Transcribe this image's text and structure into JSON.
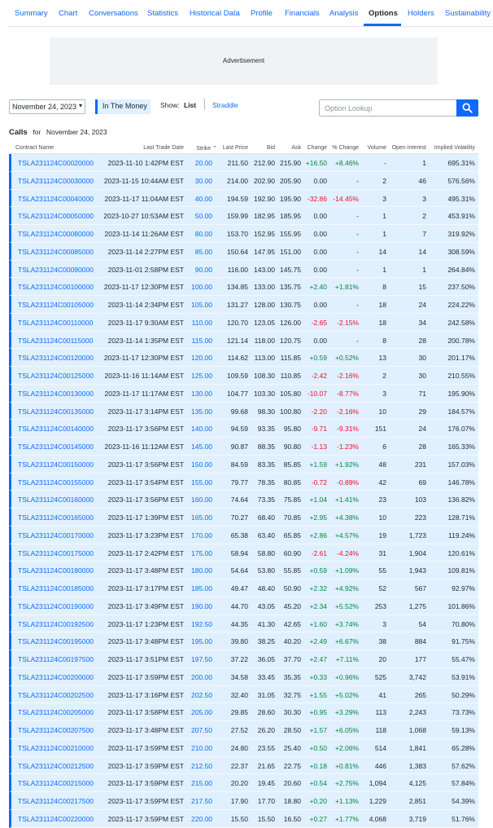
{
  "nav": {
    "tabs": [
      "Summary",
      "Chart",
      "Conversations",
      "Statistics",
      "Historical Data",
      "Profile",
      "Financials",
      "Analysis",
      "Options",
      "Holders",
      "Sustainability"
    ],
    "active": "Options"
  },
  "ad": {
    "label": "Advertisement"
  },
  "controls": {
    "expiration": "November 24, 2023",
    "in_the_money": "In The Money",
    "show_label": "Show:",
    "show_list": "List",
    "show_straddle": "Straddle",
    "lookup_placeholder": "Option Lookup"
  },
  "calls": {
    "title": "Calls",
    "for_label": "for",
    "date": "November 24, 2023"
  },
  "columns": {
    "contract": "Contract Name",
    "last_trade": "Last Trade Date",
    "strike": "Strike ⌃",
    "last_price": "Last Price",
    "bid": "Bid",
    "ask": "Ask",
    "change": "Change",
    "pct_change": "% Change",
    "volume": "Volume",
    "open_interest": "Open Interest",
    "implied_vol": "Implied Volatility"
  },
  "rows": [
    [
      "TSLA231124C00020000",
      "2023-11-10 1:42PM EST",
      "20.00",
      "211.50",
      "212.90",
      "215.90",
      "+16.50",
      "+8.46%",
      "-",
      "1",
      "695.31%"
    ],
    [
      "TSLA231124C00030000",
      "2023-11-15 10:44AM EST",
      "30.00",
      "214.00",
      "202.90",
      "205.90",
      "0.00",
      "-",
      "2",
      "46",
      "576.56%"
    ],
    [
      "TSLA231124C00040000",
      "2023-11-17 11:04AM EST",
      "40.00",
      "194.59",
      "192.90",
      "195.90",
      "-32.86",
      "-14.45%",
      "3",
      "3",
      "495.31%"
    ],
    [
      "TSLA231124C00050000",
      "2023-10-27 10:53AM EST",
      "50.00",
      "159.99",
      "182.95",
      "185.95",
      "0.00",
      "-",
      "1",
      "2",
      "453.91%"
    ],
    [
      "TSLA231124C00080000",
      "2023-11-14 11:26AM EST",
      "80.00",
      "153.70",
      "152.95",
      "155.95",
      "0.00",
      "-",
      "1",
      "7",
      "319.92%"
    ],
    [
      "TSLA231124C00085000",
      "2023-11-14 2:27PM EST",
      "85.00",
      "150.64",
      "147.95",
      "151.00",
      "0.00",
      "-",
      "14",
      "14",
      "308.59%"
    ],
    [
      "TSLA231124C00090000",
      "2023-11-01 2:58PM EST",
      "90.00",
      "116.00",
      "143.00",
      "145.75",
      "0.00",
      "-",
      "1",
      "1",
      "264.84%"
    ],
    [
      "TSLA231124C00100000",
      "2023-11-17 12:30PM EST",
      "100.00",
      "134.85",
      "133.00",
      "135.75",
      "+2.40",
      "+1.81%",
      "8",
      "15",
      "237.50%"
    ],
    [
      "TSLA231124C00105000",
      "2023-11-14 2:34PM EST",
      "105.00",
      "131.27",
      "128.00",
      "130.75",
      "0.00",
      "-",
      "18",
      "24",
      "224.22%"
    ],
    [
      "TSLA231124C00110000",
      "2023-11-17 9:30AM EST",
      "110.00",
      "120.70",
      "123.05",
      "126.00",
      "-2.65",
      "-2.15%",
      "18",
      "34",
      "242.58%"
    ],
    [
      "TSLA231124C00115000",
      "2023-11-14 1:35PM EST",
      "115.00",
      "121.14",
      "118.00",
      "120.75",
      "0.00",
      "-",
      "8",
      "28",
      "200.78%"
    ],
    [
      "TSLA231124C00120000",
      "2023-11-17 12:30PM EST",
      "120.00",
      "114.62",
      "113.00",
      "115.85",
      "+0.59",
      "+0.52%",
      "13",
      "30",
      "201.17%"
    ],
    [
      "TSLA231124C00125000",
      "2023-11-16 11:14AM EST",
      "125.00",
      "109.59",
      "108.30",
      "110.85",
      "-2.42",
      "-2.16%",
      "2",
      "30",
      "210.55%"
    ],
    [
      "TSLA231124C00130000",
      "2023-11-17 11:17AM EST",
      "130.00",
      "104.77",
      "103.30",
      "105.80",
      "-10.07",
      "-8.77%",
      "3",
      "71",
      "195.90%"
    ],
    [
      "TSLA231124C00135000",
      "2023-11-17 3:14PM EST",
      "135.00",
      "99.68",
      "98.30",
      "100.80",
      "-2.20",
      "-2.16%",
      "10",
      "29",
      "184.57%"
    ],
    [
      "TSLA231124C00140000",
      "2023-11-17 3:56PM EST",
      "140.00",
      "94.59",
      "93.35",
      "95.80",
      "-9.71",
      "-9.31%",
      "151",
      "24",
      "176.07%"
    ],
    [
      "TSLA231124C00145000",
      "2023-11-16 11:12AM EST",
      "145.00",
      "90.87",
      "88.35",
      "90.80",
      "-1.13",
      "-1.23%",
      "6",
      "28",
      "165.33%"
    ],
    [
      "TSLA231124C00150000",
      "2023-11-17 3:56PM EST",
      "150.00",
      "84.59",
      "83.35",
      "85.85",
      "+1.59",
      "+1.92%",
      "48",
      "231",
      "157.03%"
    ],
    [
      "TSLA231124C00155000",
      "2023-11-17 3:54PM EST",
      "155.00",
      "79.77",
      "78.35",
      "80.85",
      "-0.72",
      "-0.89%",
      "42",
      "69",
      "146.78%"
    ],
    [
      "TSLA231124C00160000",
      "2023-11-17 3:56PM EST",
      "160.00",
      "74.64",
      "73.35",
      "75.85",
      "+1.04",
      "+1.41%",
      "23",
      "103",
      "136.82%"
    ],
    [
      "TSLA231124C00165000",
      "2023-11-17 1:39PM EST",
      "165.00",
      "70.27",
      "68.40",
      "70.85",
      "+2.95",
      "+4.38%",
      "10",
      "223",
      "128.71%"
    ],
    [
      "TSLA231124C00170000",
      "2023-11-17 3:23PM EST",
      "170.00",
      "65.38",
      "63.40",
      "65.85",
      "+2.86",
      "+4.57%",
      "19",
      "1,723",
      "119.24%"
    ],
    [
      "TSLA231124C00175000",
      "2023-11-17 2:42PM EST",
      "175.00",
      "58.94",
      "58.80",
      "60.90",
      "-2.61",
      "-4.24%",
      "31",
      "1,904",
      "120.61%"
    ],
    [
      "TSLA231124C00180000",
      "2023-11-17 3:48PM EST",
      "180.00",
      "54.64",
      "53.80",
      "55.85",
      "+0.59",
      "+1.09%",
      "55",
      "1,943",
      "109.81%"
    ],
    [
      "TSLA231124C00185000",
      "2023-11-17 3:17PM EST",
      "185.00",
      "49.47",
      "48.40",
      "50.90",
      "+2.32",
      "+4.92%",
      "52",
      "567",
      "92.97%"
    ],
    [
      "TSLA231124C00190000",
      "2023-11-17 3:49PM EST",
      "190.00",
      "44.70",
      "43.05",
      "45.20",
      "+2.34",
      "+5.52%",
      "253",
      "1,275",
      "101.86%"
    ],
    [
      "TSLA231124C00192500",
      "2023-11-17 1:23PM EST",
      "192.50",
      "44.35",
      "41.30",
      "42.65",
      "+1.60",
      "+3.74%",
      "3",
      "54",
      "70.80%"
    ],
    [
      "TSLA231124C00195000",
      "2023-11-17 3:48PM EST",
      "195.00",
      "39.80",
      "38.25",
      "40.20",
      "+2.49",
      "+6.67%",
      "38",
      "884",
      "91.75%"
    ],
    [
      "TSLA231124C00197500",
      "2023-11-17 3:51PM EST",
      "197.50",
      "37.22",
      "36.05",
      "37.70",
      "+2.47",
      "+7.11%",
      "20",
      "177",
      "55.47%"
    ],
    [
      "TSLA231124C00200000",
      "2023-11-17 3:59PM EST",
      "200.00",
      "34.58",
      "33.45",
      "35.35",
      "+0.33",
      "+0.96%",
      "525",
      "3,742",
      "53.91%"
    ],
    [
      "TSLA231124C00202500",
      "2023-11-17 3:16PM EST",
      "202.50",
      "32.40",
      "31.05",
      "32.75",
      "+1.55",
      "+5.02%",
      "41",
      "265",
      "50.29%"
    ],
    [
      "TSLA231124C00205000",
      "2023-11-17 3:58PM EST",
      "205.00",
      "29.85",
      "28.60",
      "30.30",
      "+0.95",
      "+3.29%",
      "113",
      "2,243",
      "73.73%"
    ],
    [
      "TSLA231124C00207500",
      "2023-11-17 3:48PM EST",
      "207.50",
      "27.52",
      "26.20",
      "28.50",
      "+1.57",
      "+6.05%",
      "118",
      "1,068",
      "59.13%"
    ],
    [
      "TSLA231124C00210000",
      "2023-11-17 3:59PM EST",
      "210.00",
      "24.80",
      "23.55",
      "25.40",
      "+0.50",
      "+2.06%",
      "514",
      "1,841",
      "65.28%"
    ],
    [
      "TSLA231124C00212500",
      "2023-11-17 3:59PM EST",
      "212.50",
      "22.37",
      "21.65",
      "22.75",
      "+0.18",
      "+0.81%",
      "446",
      "1,383",
      "57.62%"
    ],
    [
      "TSLA231124C00215000",
      "2023-11-17 3:59PM EST",
      "215.00",
      "20.20",
      "19.45",
      "20.60",
      "+0.54",
      "+2.75%",
      "1,094",
      "4,125",
      "57.84%"
    ],
    [
      "TSLA231124C00217500",
      "2023-11-17 3:59PM EST",
      "217.50",
      "17.90",
      "17.70",
      "18.80",
      "+0.20",
      "+1.13%",
      "1,229",
      "2,851",
      "54.39%"
    ],
    [
      "TSLA231124C00220000",
      "2023-11-17 3:59PM EST",
      "220.00",
      "15.50",
      "15.50",
      "16.50",
      "+0.27",
      "+1.77%",
      "4,068",
      "3,719",
      "51.76%"
    ]
  ],
  "colors": {
    "accent": "#0f69ff",
    "itm_bg": "#e0f0ff",
    "positive": "#00873c",
    "negative": "#eb0f29"
  },
  "icons": {
    "lookup": "search-icon",
    "dropdown": "chevron-down-icon"
  }
}
